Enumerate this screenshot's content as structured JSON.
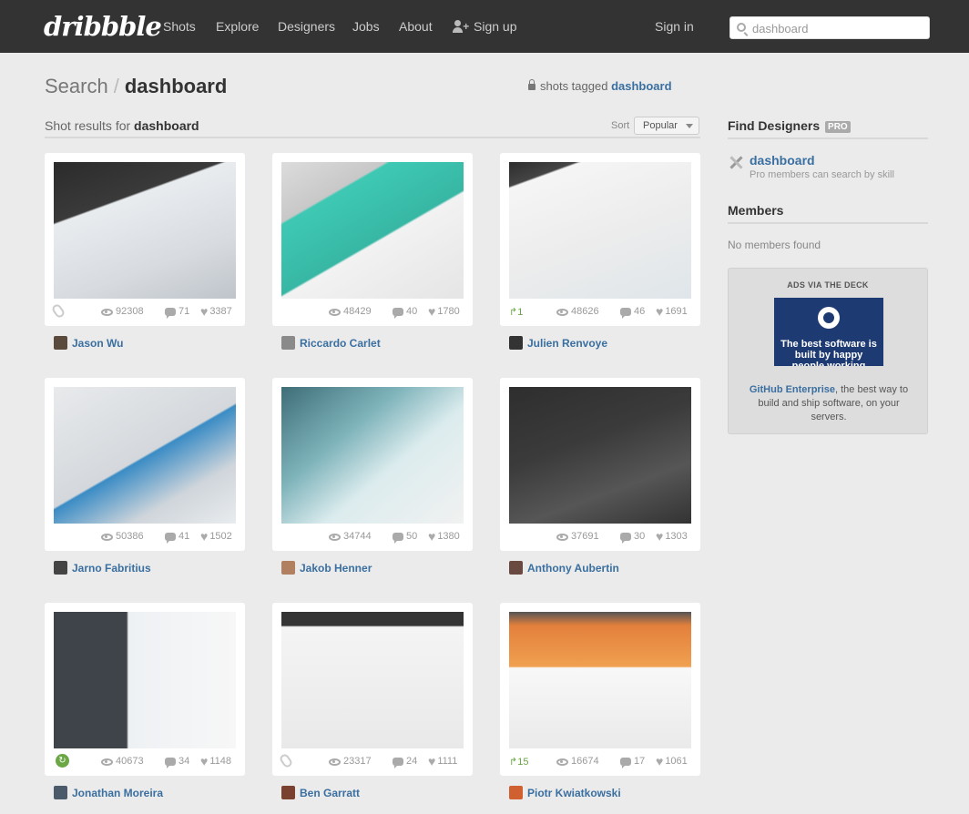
{
  "header": {
    "logo": "dribbble",
    "nav": [
      "Shots",
      "Explore",
      "Designers",
      "Jobs",
      "About"
    ],
    "signup": "Sign up",
    "signin": "Sign in",
    "search_value": "dashboard"
  },
  "title": {
    "prefix": "Search",
    "separator": "/",
    "query": "dashboard",
    "tagged_text": "shots tagged",
    "tagged_link": "dashboard"
  },
  "results": {
    "label": "Shot results for",
    "query": "dashboard",
    "sort_label": "Sort",
    "sort_value": "Popular"
  },
  "shots": [
    {
      "views": "92308",
      "comments": "71",
      "likes": "3387",
      "rebounds": "",
      "attachment": true,
      "player": "Jason Wu"
    },
    {
      "views": "48429",
      "comments": "40",
      "likes": "1780",
      "rebounds": "",
      "attachment": false,
      "player": "Riccardo Carlet"
    },
    {
      "views": "48626",
      "comments": "46",
      "likes": "1691",
      "rebounds": "1",
      "attachment": false,
      "player": "Julien Renvoye"
    },
    {
      "views": "50386",
      "comments": "41",
      "likes": "1502",
      "rebounds": "",
      "attachment": false,
      "player": "Jarno Fabritius"
    },
    {
      "views": "34744",
      "comments": "50",
      "likes": "1380",
      "rebounds": "",
      "attachment": false,
      "player": "Jakob Henner"
    },
    {
      "views": "37691",
      "comments": "30",
      "likes": "1303",
      "rebounds": "",
      "attachment": false,
      "player": "Anthony Aubertin"
    },
    {
      "views": "40673",
      "comments": "34",
      "likes": "1148",
      "rebounds": "",
      "attachment": false,
      "player": "Jonathan Moreira"
    },
    {
      "views": "23317",
      "comments": "24",
      "likes": "1111",
      "rebounds": "",
      "attachment": true,
      "player": "Ben Garratt"
    },
    {
      "views": "16674",
      "comments": "17",
      "likes": "1061",
      "rebounds": "15",
      "attachment": false,
      "player": "Piotr Kwiatkowski"
    }
  ],
  "sidebar": {
    "find_designers": "Find Designers",
    "pro_badge": "PRO",
    "skill_link": "dashboard",
    "skill_note": "Pro members can search by skill",
    "members_title": "Members",
    "no_members": "No members found",
    "ad": {
      "heading": "ADS VIA THE DECK",
      "image_text": "The best software is built by happy people working together",
      "link": "GitHub Enterprise",
      "copy": ", the best way to build and ship software, on your servers."
    }
  },
  "colors": {
    "header": "#333333",
    "link": "#3a6fa0",
    "rebound": "#6ba744",
    "background": "#ebebeb"
  }
}
